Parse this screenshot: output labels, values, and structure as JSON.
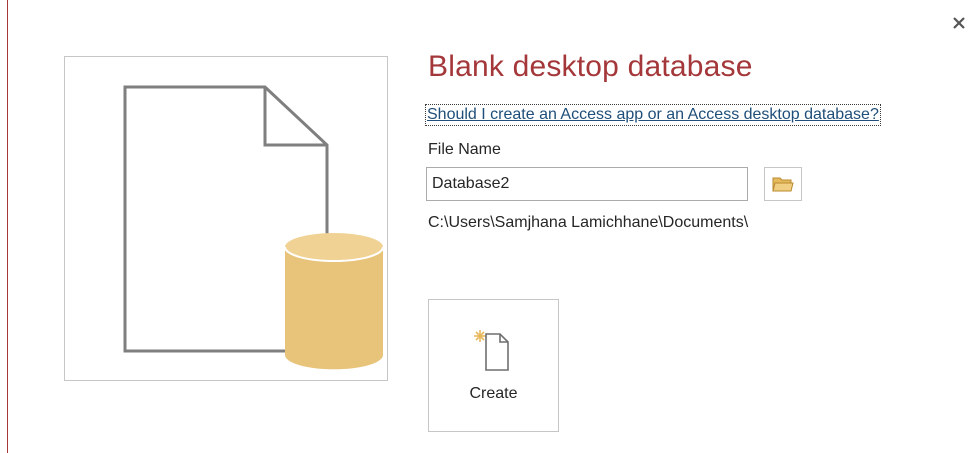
{
  "dialog": {
    "close_label": "×",
    "title": "Blank desktop database",
    "help_link": "Should I create an Access app or an Access desktop database?",
    "file_name_label": "File Name",
    "file_name_value": "Database2",
    "save_path": "C:\\Users\\Samjhana Lamichhane\\Documents\\",
    "create_label": "Create"
  },
  "icons": {
    "close": "close-icon",
    "browse": "folder-icon",
    "preview": "blank-database-illustration",
    "create": "new-document-icon"
  },
  "colors": {
    "accent": "#a4373a",
    "link": "#1e4e79",
    "cylinder": "#e8c37a",
    "folder": "#e7b95d"
  }
}
